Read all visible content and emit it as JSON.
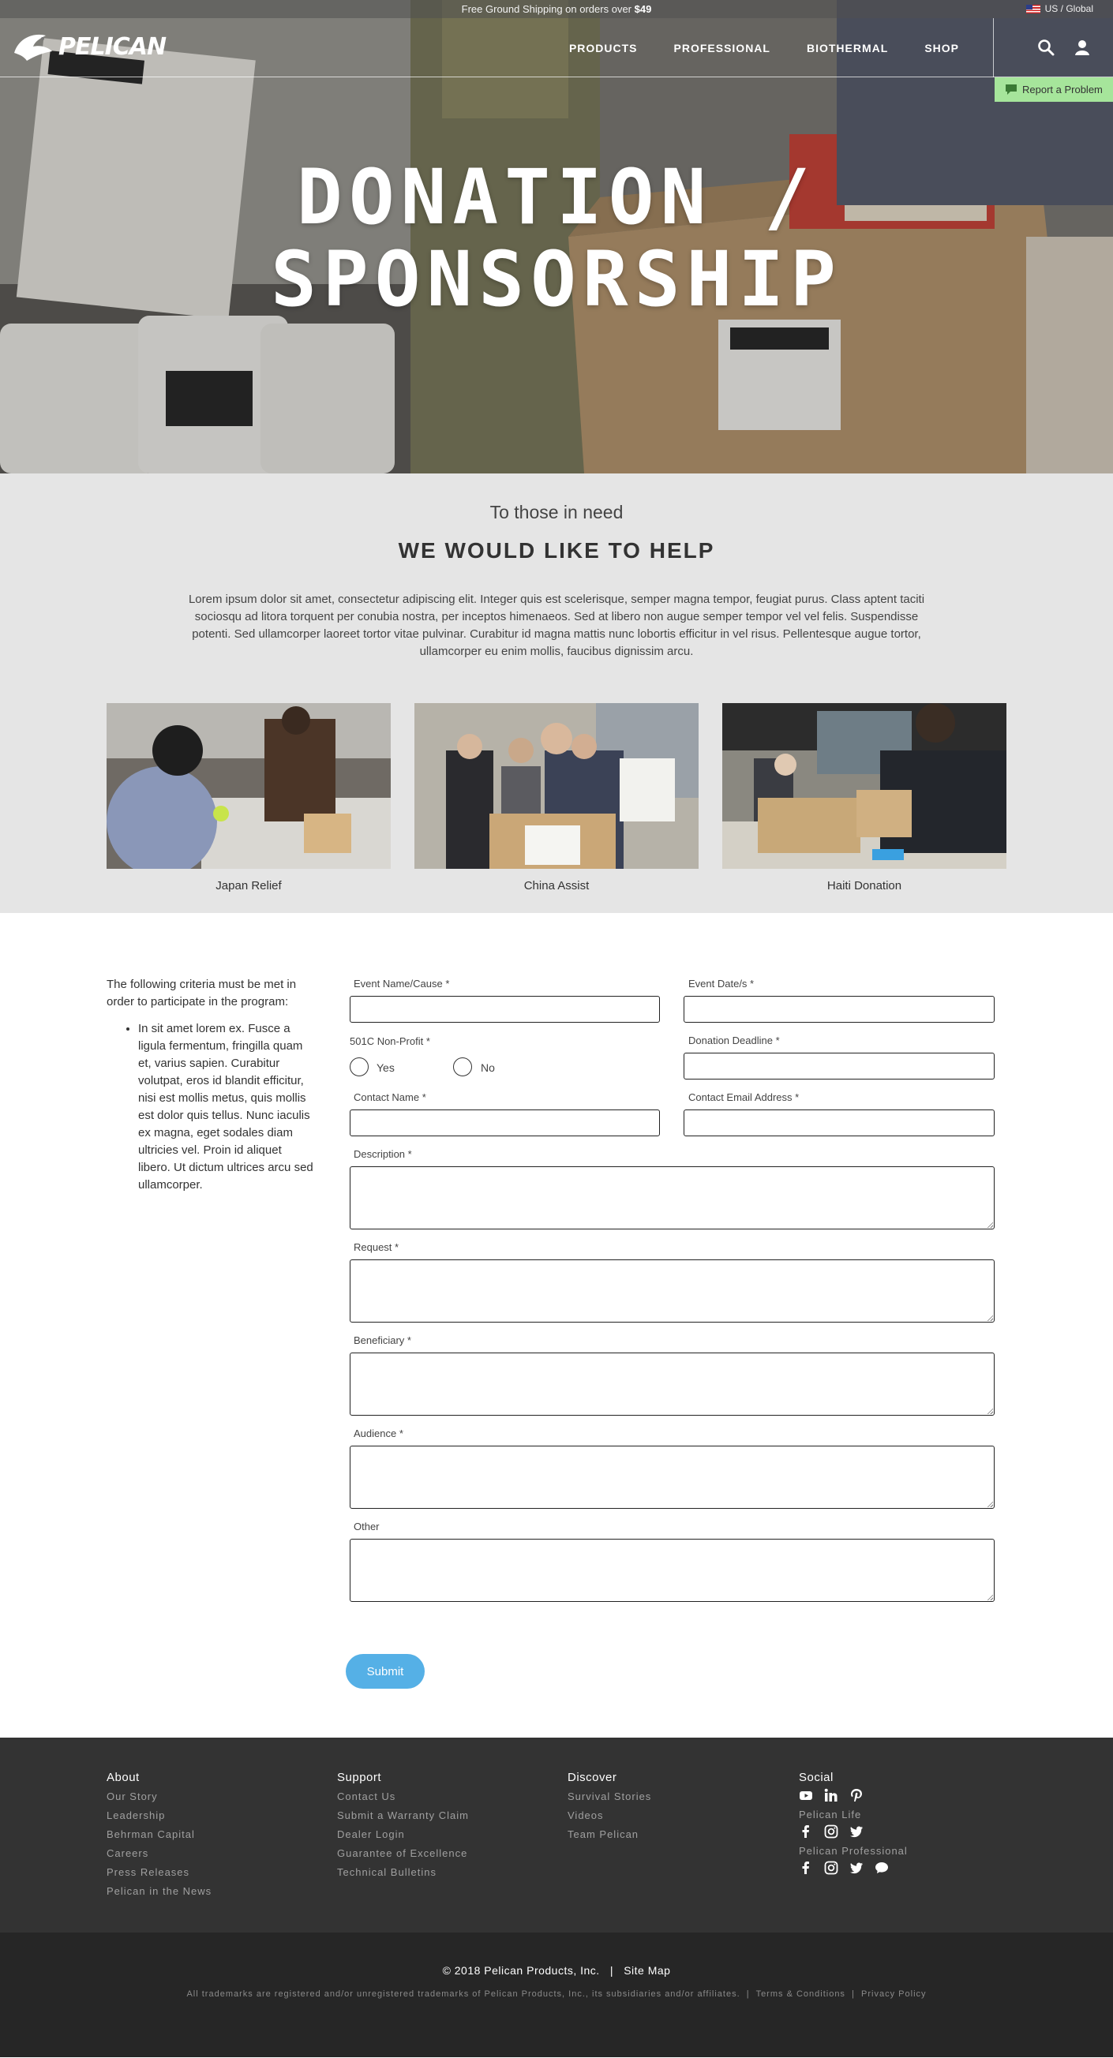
{
  "topbar": {
    "text": "Free Ground Shipping on orders over ",
    "amount": "$49",
    "locale": "US / Global"
  },
  "nav": {
    "logo": "PELICAN",
    "links": [
      "PRODUCTS",
      "PROFESSIONAL",
      "BIOTHERMAL",
      "SHOP"
    ],
    "report": "Report a Problem"
  },
  "hero": {
    "title_line1": "DONATION /",
    "title_line2": "SPONSORSHIP"
  },
  "intro": {
    "subtitle": "To those in need",
    "title": "WE WOULD LIKE TO HELP",
    "text": "Lorem ipsum dolor sit amet, consectetur adipiscing elit. Integer quis est scelerisque, semper magna tempor, feugiat purus. Class aptent taciti sociosqu ad litora torquent per conubia nostra, per inceptos himenaeos. Sed at libero non augue semper tempor vel vel felis. Suspendisse potenti. Sed ullamcorper laoreet tortor vitae pulvinar. Curabitur id magna mattis nunc lobortis efficitur in vel risus. Pellentesque augue tortor, ullamcorper eu enim mollis, faucibus dignissim arcu.",
    "photos": [
      "Japan Relief",
      "China Assist",
      "Haiti Donation"
    ]
  },
  "form": {
    "criteria_intro": "The following criteria must be met in order to participate in the program:",
    "criteria_item": "In sit amet lorem ex. Fusce a ligula fermentum, fringilla quam et, varius sapien. Curabitur volutpat, eros id blandit efficitur, nisi est mollis metus, quis mollis est dolor quis tellus. Nunc iaculis ex magna, eget sodales diam ultricies vel. Proin id aliquet libero. Ut dictum ultrices arcu sed ullamcorper.",
    "event_name": "Event Name/Cause *",
    "event_dates": "Event Date/s *",
    "nonprofit": "501C Non-Profit *",
    "yes": "Yes",
    "no": "No",
    "deadline": "Donation Deadline *",
    "contact_name": "Contact Name *",
    "contact_email": "Contact Email Address *",
    "description": "Description *",
    "request": "Request *",
    "beneficiary": "Beneficiary *",
    "audience": "Audience *",
    "other": "Other",
    "submit": "Submit"
  },
  "footer": {
    "about": {
      "title": "About",
      "links": [
        "Our Story",
        "Leadership",
        "Behrman Capital",
        "Careers",
        "Press Releases",
        "Pelican in the News"
      ]
    },
    "support": {
      "title": "Support",
      "links": [
        "Contact Us",
        "Submit a Warranty Claim",
        "Dealer Login",
        "Guarantee of Excellence",
        "Technical Bulletins"
      ]
    },
    "discover": {
      "title": "Discover",
      "links": [
        "Survival Stories",
        "Videos",
        "Team Pelican"
      ]
    },
    "social": {
      "title": "Social",
      "life": "Pelican Life",
      "professional": "Pelican Professional"
    },
    "copyright": "© 2018 Pelican Products, Inc.",
    "sep": "|",
    "sitemap": "Site Map",
    "legal": "All trademarks are registered and/or unregistered trademarks of Pelican Products, Inc., its subsidiaries and/or affiliates.",
    "terms": "Terms & Conditions",
    "privacy": "Privacy Policy"
  },
  "colors": {
    "accent": "#55b0e6",
    "report_bg": "#a6e59b",
    "footer_bg": "#333333",
    "intro_bg": "#e5e5e5"
  },
  "icons": [
    "search-icon",
    "user-icon",
    "chat-icon",
    "youtube-icon",
    "linkedin-icon",
    "pinterest-icon",
    "facebook-icon",
    "instagram-icon",
    "twitter-icon"
  ]
}
